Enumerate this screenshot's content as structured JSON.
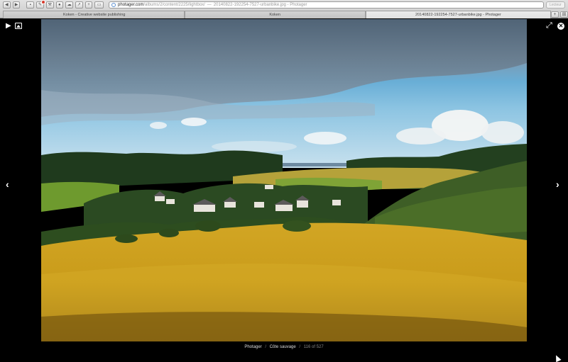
{
  "browser": {
    "url": {
      "domain": "photager.com",
      "path": "/albums/2/content/2225/lightbox/",
      "separator": "—",
      "page_title": "20140822-192254-7527-urbanbike.jpg - Photager"
    },
    "reader_label": "Lecteur",
    "tabs": [
      {
        "label": "Koken - Creative website publishing"
      },
      {
        "label": "Koken"
      },
      {
        "label": "20140822-192254-7527-urbanbike.jpg - Photager"
      }
    ],
    "new_tab_label": "+",
    "tab_overview_label": "⊞"
  },
  "lightbox": {
    "icons": {
      "play": "play-icon",
      "slideshow": "image-icon",
      "fullscreen": "expand-icon",
      "close": "close-icon",
      "prev": "chevron-left-icon",
      "next": "chevron-right-icon"
    },
    "glyphs": {
      "play": "▶",
      "fullscreen": "⤢",
      "close": "✕",
      "prev": "‹",
      "next": "›"
    },
    "caption": {
      "site": "Photager",
      "album": "Côte sauvage",
      "counter": "116 of 527",
      "separator": "/"
    }
  }
}
